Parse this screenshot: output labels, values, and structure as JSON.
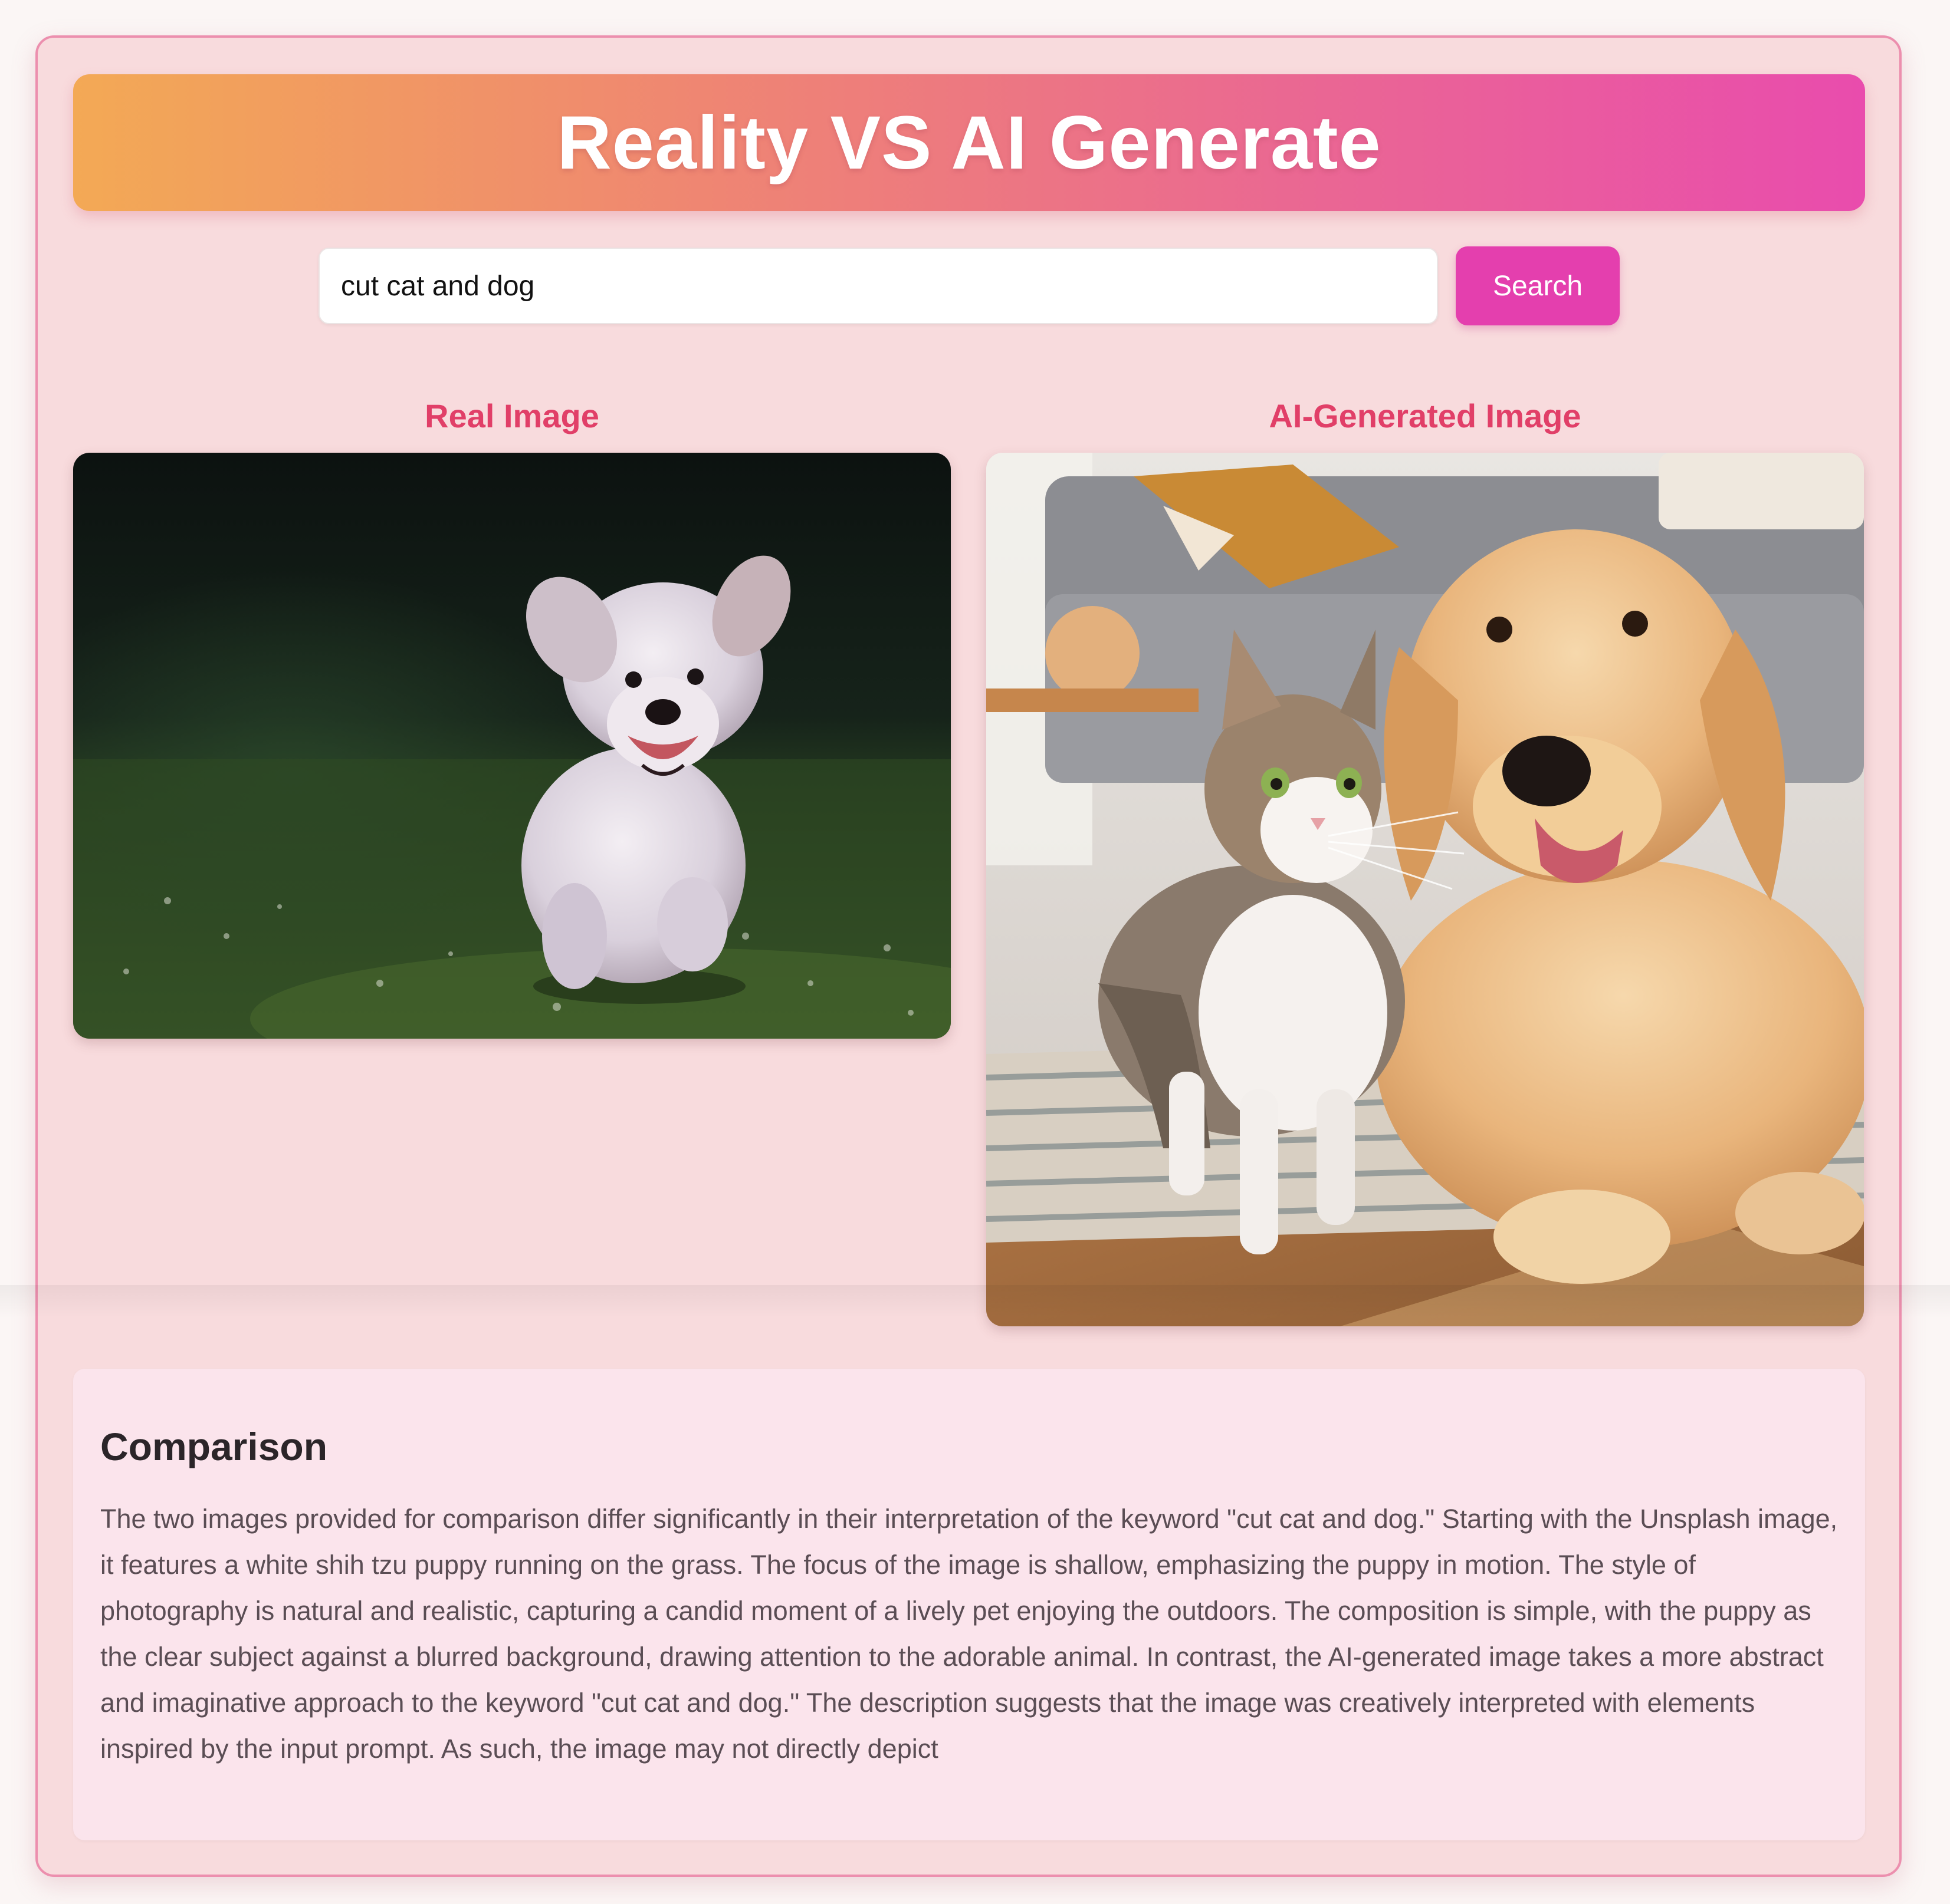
{
  "header": {
    "title": "Reality VS AI Generate"
  },
  "search": {
    "value": "cut cat and dog",
    "button_label": "Search"
  },
  "results": {
    "real_heading": "Real Image",
    "ai_heading": "AI-Generated Image"
  },
  "comparison": {
    "heading": "Comparison",
    "text": "The two images provided for comparison differ significantly in their interpretation of the keyword \"cut cat and dog.\" Starting with the Unsplash image, it features a white shih tzu puppy running on the grass. The focus of the image is shallow, emphasizing the puppy in motion. The style of photography is natural and realistic, capturing a candid moment of a lively pet enjoying the outdoors. The composition is simple, with the puppy as the clear subject against a blurred background, drawing attention to the adorable animal. In contrast, the AI-generated image takes a more abstract and imaginative approach to the keyword \"cut cat and dog.\" The description suggests that the image was creatively interpreted with elements inspired by the input prompt. As such, the image may not directly depict"
  },
  "colors": {
    "accent": "#e43fae",
    "heading": "#e13f68",
    "banner_start": "#f3a955",
    "banner_end": "#e94cad",
    "card_background": "#f8dbdd",
    "card_border": "#ec8fae"
  }
}
